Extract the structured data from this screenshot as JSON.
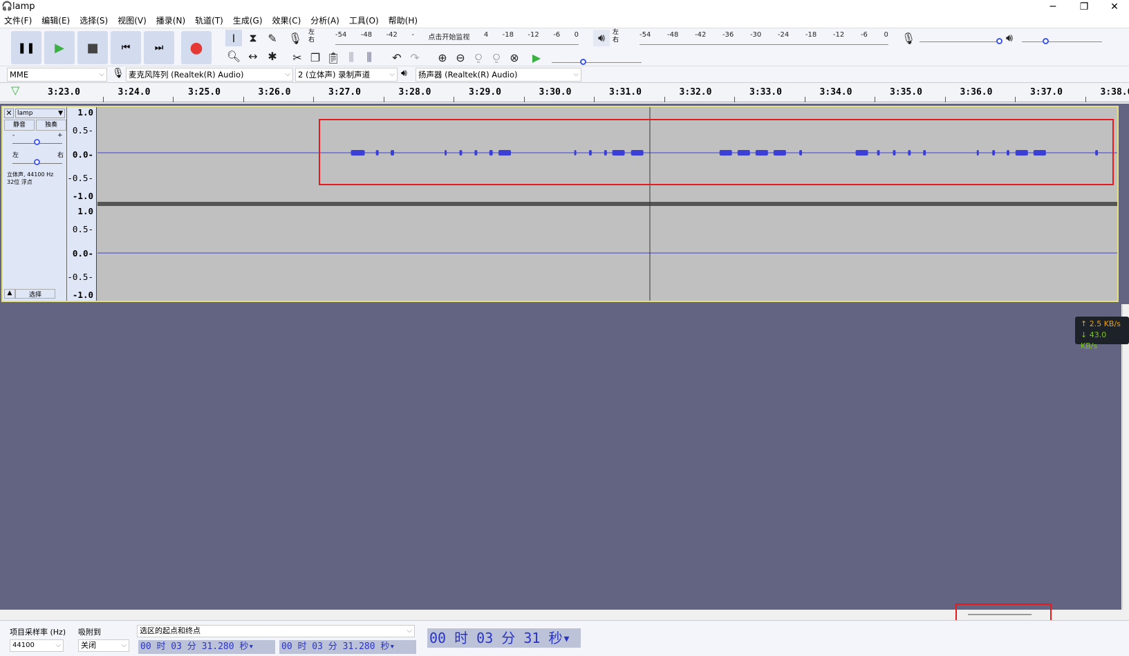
{
  "window": {
    "title": "lamp",
    "minimize": "─",
    "restore": "❐",
    "close": "✕"
  },
  "menu": [
    "文件(F)",
    "编辑(E)",
    "选择(S)",
    "视图(V)",
    "播录(N)",
    "轨道(T)",
    "生成(G)",
    "效果(C)",
    "分析(A)",
    "工具(O)",
    "帮助(H)"
  ],
  "transport": {
    "pause": "❚❚",
    "play": "▶",
    "stop": "■",
    "skip_start": "⏮",
    "skip_end": "⏭",
    "record": "●"
  },
  "colors": {
    "play": "#3cb043",
    "record": "#e53935",
    "waveform": "#3b3fd6",
    "selection_border": "#e4e07c",
    "background": "#626482",
    "highlight": "#e8191c"
  },
  "record_meter": {
    "lr": "左\n右",
    "ticks": [
      "-54",
      "-48",
      "-42",
      "-",
      "点击开始监视",
      "4",
      "-18",
      "-12",
      "-6",
      "0"
    ]
  },
  "play_meter": {
    "lr": "左\n右",
    "ticks": [
      "-54",
      "-48",
      "-42",
      "-36",
      "-30",
      "-24",
      "-18",
      "-12",
      "-6",
      "0"
    ]
  },
  "mixer": {
    "rec_volume": 1.0,
    "play_volume": 0.3,
    "play_at_speed": 0.35,
    "minus": "-",
    "plus": "+"
  },
  "devices": {
    "host": "MME",
    "mic": "麦克风阵列 (Realtek(R) Audio)",
    "channels": "2 (立体声) 录制声道",
    "speaker": "扬声器 (Realtek(R) Audio)"
  },
  "ruler": [
    "3:23.0",
    "3:24.0",
    "3:25.0",
    "3:26.0",
    "3:27.0",
    "3:28.0",
    "3:29.0",
    "3:30.0",
    "3:31.0",
    "3:32.0",
    "3:33.0",
    "3:34.0",
    "3:35.0",
    "3:36.0",
    "3:37.0",
    "3:38.0"
  ],
  "track": {
    "name": "lamp",
    "mute": "静音",
    "solo": "独奏",
    "gain_minus": "-",
    "gain_plus": "+",
    "pan_left": "左",
    "pan_right": "右",
    "gain": 0.5,
    "pan": 0.5,
    "info1": "立体声, 44100 Hz",
    "info2": "32位 浮点",
    "select": "选择",
    "collapse": "▲"
  },
  "vruler": [
    "1.0",
    "0.5",
    "0.0",
    "-0.5",
    "-1.0"
  ],
  "network": {
    "up": "↑ 2.5 KB/s",
    "down": "↓ 43.0 KB/s"
  },
  "status": {
    "rate_label": "项目采样率 (Hz)",
    "rate": "44100",
    "snap_label": "吸附到",
    "snap": "关闭",
    "sel_mode": "选区的起点和终点",
    "sel_start": "00 时 03 分 31.280 秒",
    "sel_end": "00 时 03 分 31.280 秒",
    "position": "00 时 03 分 31 秒"
  }
}
